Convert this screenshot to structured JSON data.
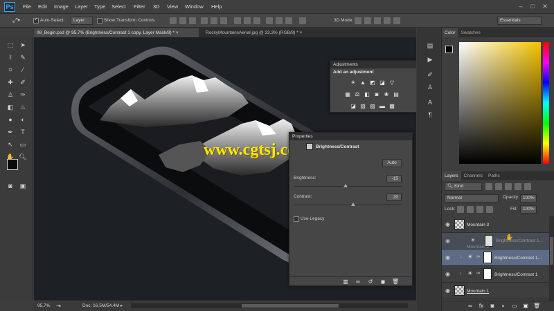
{
  "app": {
    "logo": "Ps"
  },
  "menu": [
    "File",
    "Edit",
    "Image",
    "Layer",
    "Type",
    "Select",
    "Filter",
    "3D",
    "View",
    "Window",
    "Help"
  ],
  "options": {
    "auto_select_label": "Auto-Select:",
    "auto_select_value": "Layer",
    "show_transform_label": "Show Transform Controls",
    "mode_3d_label": "3D Mode:",
    "workspace": "Essentials"
  },
  "tabs": [
    {
      "label": "08_Begin.psd @ 95.7% (Brightness/Contrast 1 copy, Layer Mask/8) *"
    },
    {
      "label": "RockyMountainsAerial.jpg @ 33.3% (RGB/8) *"
    }
  ],
  "status": {
    "zoom": "95.7%",
    "doc": "Doc: 16.5M/54.4M"
  },
  "watermark": "www.cgtsj.com",
  "adjustments": {
    "title": "Adjustments",
    "subtitle": "Add an adjustment"
  },
  "properties": {
    "title": "Properties",
    "layer_type": "Brightness/Contrast",
    "auto_button": "Auto",
    "brightness_label": "Brightness:",
    "brightness_value": "-15",
    "brightness_fraction": 0.48,
    "contrast_label": "Contrast:",
    "contrast_value": "20",
    "contrast_fraction": 0.55,
    "legacy_label": "Use Legacy"
  },
  "color_panel": {
    "tabs": [
      "Color",
      "Swatches"
    ]
  },
  "layers_panel": {
    "tabs": [
      "Layers",
      "Channels",
      "Paths"
    ],
    "kind": "Kind",
    "blend_mode": "Normal",
    "opacity_label": "Opacity:",
    "opacity_value": "100%",
    "lock_label": "Lock:",
    "fill_label": "Fill:",
    "fill_value": "100%",
    "layers": [
      {
        "name": "Mountain 3"
      },
      {
        "name": "Brightness/Contrast 1..."
      },
      {
        "name": "Mountain 2"
      },
      {
        "name": "Brightness/Contrast 1..."
      },
      {
        "name": "Brightness/Contrast 1"
      },
      {
        "name": "Mountain 1"
      }
    ]
  },
  "colors": {
    "accent": "#31a8ff",
    "watermark": "#ffe800",
    "selected_row": "#5d6b84"
  }
}
